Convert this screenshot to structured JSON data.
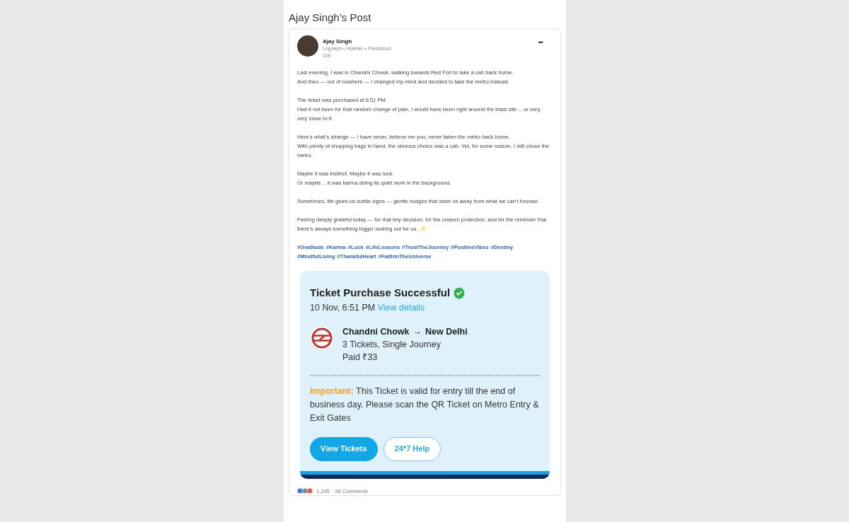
{
  "page_title": "Ajay Singh’s Post",
  "post": {
    "author": "Ajay Singh",
    "headline": "Logolept • Hotelier • Precarious",
    "time": "10h",
    "menu": "•••",
    "paragraphs": [
      [
        "Last evening, I was in Chandni Chowk, walking towards Red Fort to take a cab back home.",
        "And then — out of nowhere — I changed my mind and decided to take the metro instead."
      ],
      [
        "The ticket was purchased at 6:51 PM.",
        "Had it not been for that random change of plan, I would have been right around the blast site… or very, very close to it."
      ],
      [
        "Here’s what’s strange — I have never, believe me you, never taken the metro back home.",
        "With plenty of shopping bags in hand, the obvious choice was a cab. Yet, for some reason, I still chose the metro."
      ],
      [
        "Maybe it was instinct. Maybe it was luck.",
        "Or maybe… it was karma doing its quiet work in the background."
      ],
      [
        "Sometimes, life gives us subtle signs — gentle nudges that steer us away from what we can’t foresee."
      ],
      [
        "Feeling deeply grateful today — for that tiny decision, for the unseen protection, and for the reminder that there’s always something bigger looking out for us. ✨"
      ]
    ],
    "hashtags": [
      "#Gratitude",
      "#Karma",
      "#Luck",
      "#LifeLessons",
      "#TrustTheJourney",
      "#PositiveVibes",
      "#Destiny",
      "#MindfulLiving",
      "#ThankfulHeart",
      "#FaithInTheUniverse"
    ],
    "ticket": {
      "title": "Ticket Purchase Successful",
      "date": "10 Nov, 6:51 PM",
      "details_link": "View details",
      "from": "Chandni Chowk",
      "arrow": "→",
      "to": "New Delhi",
      "tickets": "3 Tickets, Single Journey",
      "paid": "Paid ₹33",
      "important_label": "Important:",
      "important_text": "This Ticket is valid for entry till the end of business day. Please scan the QR Ticket on Metro Entry & Exit Gates",
      "buttons": [
        {
          "label": "View Tickets",
          "kind": "primary"
        },
        {
          "label": "24*7 Help",
          "kind": "outline"
        }
      ]
    },
    "reactions": "1,245",
    "comments": "· 38 Comments"
  }
}
